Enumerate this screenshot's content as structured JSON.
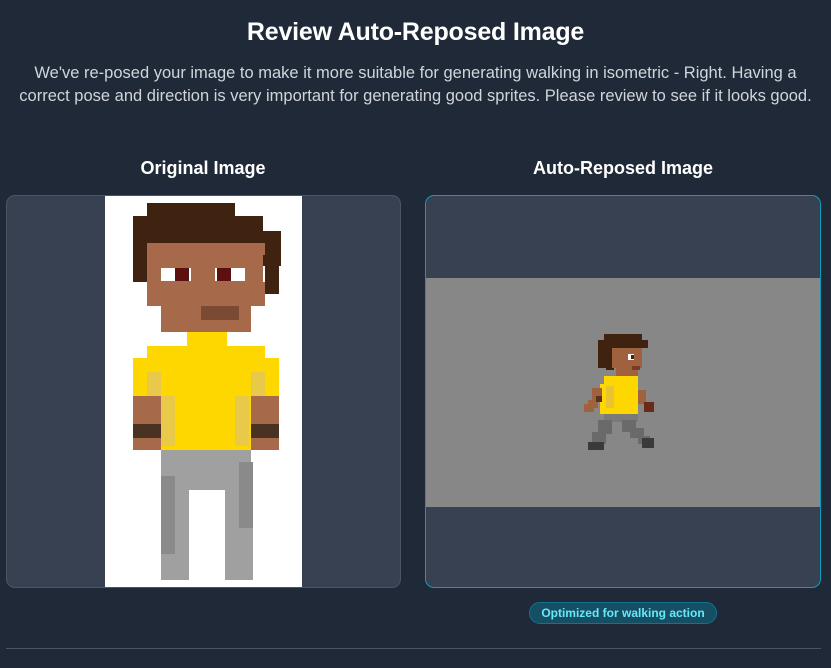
{
  "dialog": {
    "title": "Review Auto-Reposed Image",
    "description": "We've re-posed your image to make it more suitable for generating walking in isometric - Right. Having a correct pose and direction is very important for generating good sprites. Please review to see if it looks good."
  },
  "original": {
    "heading": "Original Image",
    "image_alt": "pixel-art character facing front"
  },
  "reposed": {
    "heading": "Auto-Reposed Image",
    "image_alt": "pixel-art character walking right",
    "badge": "Optimized for walking action"
  },
  "colors": {
    "background": "#1f2937",
    "panel": "#374151",
    "accent": "#0e9db5",
    "badge_text": "#67e8f9"
  }
}
